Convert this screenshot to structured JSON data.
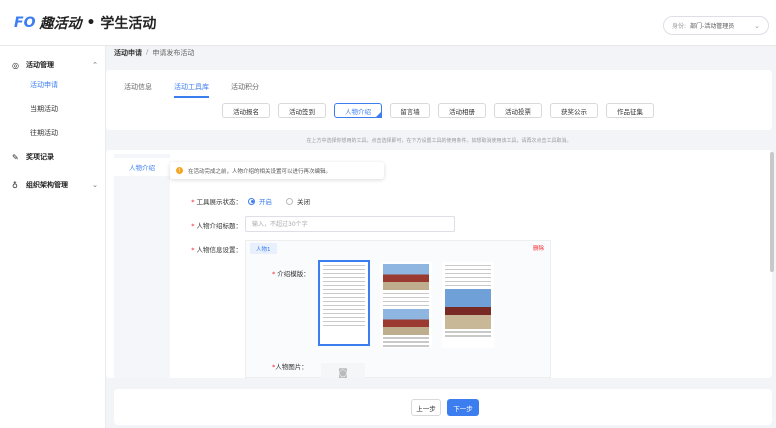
{
  "app": {
    "logo_mark": "FO",
    "brand": "趣活动",
    "dot": "•",
    "title": "学生活动"
  },
  "role": {
    "label": "身份:",
    "value": "部门-活动管理员"
  },
  "sidebar": {
    "groups": [
      {
        "label": "活动管理",
        "icon": "activity-icon"
      },
      {
        "label": "奖项记录",
        "icon": "award-icon"
      },
      {
        "label": "组织架构管理",
        "icon": "org-icon"
      }
    ],
    "sub": [
      "活动申请",
      "当期活动",
      "往期活动"
    ]
  },
  "breadcrumb": {
    "current": "活动申请",
    "sep": "/",
    "leaf": "申请发布活动"
  },
  "tabs": [
    "活动信息",
    "活动工具库",
    "活动积分"
  ],
  "tools": [
    "活动报名",
    "活动签到",
    "人物介绍",
    "留言墙",
    "活动相册",
    "活动投票",
    "获奖公示",
    "作品征集"
  ],
  "hint": "在上方中选择你想用的工具，点击选择即可，在下方设置工具的使用条件。如想取消使用该工具，请再次点击工具取消。",
  "vtab": "人物介绍",
  "notice": "在活动完成之前，人物介绍的相关设置可以进行再次编辑。",
  "form": {
    "status_label": "工具展示状态：",
    "on": "开启",
    "off": "关闭",
    "title_label": "人物介绍标题：",
    "title_placeholder": "输入，不超过30个字",
    "info_label": "人物信息设置：",
    "person_tab": "人物1",
    "delete": "删除",
    "template_label": "介绍模版：",
    "image_label": "人物图片："
  },
  "footer": {
    "prev": "上一步",
    "next": "下一步"
  },
  "colors": {
    "accent": "#3c7df0",
    "required": "#f5222d"
  }
}
